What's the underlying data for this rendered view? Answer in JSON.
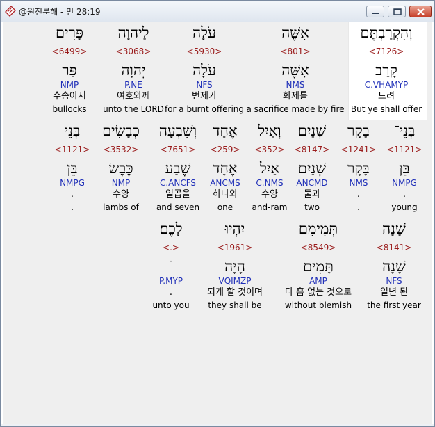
{
  "window": {
    "title": "@원전분해 - 민 28:19",
    "icon": "bible-app-icon",
    "controls": {
      "minimize": "minimize-icon",
      "maximize": "maximize-icon",
      "close": "close-icon"
    }
  },
  "colors": {
    "strongs": "#9a1b1b",
    "parsing": "#1f2fb8",
    "text": "#000000",
    "background": "#efefef"
  },
  "rows": [
    {
      "words": [
        {
          "heb": "וְהִקְרַבְתֶּם",
          "num": "<7126>",
          "root": "קָרַב",
          "parse": "C.VHAMYP",
          "kor": "드려",
          "eng": "But ye shall offer",
          "highlight": true
        },
        {
          "heb": "אִשֶּׁה",
          "num": "<801>",
          "root": "אִשֶּׁה",
          "parse": "NMS",
          "kor": "화제를",
          "eng": "a sacrifice made by fire"
        },
        {
          "heb": "עֹלָה",
          "num": "<5930>",
          "root": "עֹלָה",
          "parse": "NFS",
          "kor": "번제가",
          "eng": "for a burnt offering"
        },
        {
          "heb": "לַיהוָה",
          "num": "<3068>",
          "root": "יְהוָה",
          "parse": "P.NE",
          "kor": "여호와께",
          "eng": "unto the LORD"
        },
        {
          "heb": "פָּרִים",
          "num": "<6499>",
          "root": "פַּר",
          "parse": "NMP",
          "kor": "수송아지",
          "eng": "bullocks"
        }
      ]
    },
    {
      "words": [
        {
          "heb": "בְּנֵי־",
          "num": "<1121>",
          "root": "בֵּן",
          "parse": "NMPG",
          "kor": ".",
          "eng": "young"
        },
        {
          "heb": "בָקָר",
          "num": "<1241>",
          "root": "בָּקָר",
          "parse": "NMS",
          "kor": ".",
          "eng": "."
        },
        {
          "heb": "שְׁנַיִם",
          "num": "<8147>",
          "root": "שְׁנַיִם",
          "parse": "ANCMD",
          "kor": "둘과",
          "eng": "two"
        },
        {
          "heb": "וְאַיִל",
          "num": "<352>",
          "root": "אַיִל",
          "parse": "C.NMS",
          "kor": "수양",
          "eng": "and-ram"
        },
        {
          "heb": "אֶחָד",
          "num": "<259>",
          "root": "אֶחָד",
          "parse": "ANCMS",
          "kor": "하나와",
          "eng": "one"
        },
        {
          "heb": "וְשִׁבְעָה",
          "num": "<7651>",
          "root": "שֶׁבַע",
          "parse": "C.ANCFS",
          "kor": "일곱을",
          "eng": "and seven"
        },
        {
          "heb": "כְבָשִׂים",
          "num": "<3532>",
          "root": "כֶּבֶשׂ",
          "parse": "NMP",
          "kor": "수양",
          "eng": "lambs of"
        },
        {
          "heb": "בְּנֵי",
          "num": "<1121>",
          "root": "בֵּן",
          "parse": "NMPG",
          "kor": ".",
          "eng": "."
        }
      ]
    },
    {
      "words": [
        {
          "heb": "שָׁנָה",
          "num": "<8141>",
          "root": "שָׁנָה",
          "parse": "NFS",
          "kor": "일년 된",
          "eng": "the first year"
        },
        {
          "heb": "תְּמִימִם",
          "num": "<8549>",
          "root": "תָּמִים",
          "parse": "AMP",
          "kor": "다 흠 없는 것으로",
          "eng": "without blemish"
        },
        {
          "heb": "יִהְיוּ",
          "num": "<1961>",
          "root": "הָיָה",
          "parse": "VQIMZP",
          "kor": "되게 할 것이며",
          "eng": "they shall be"
        },
        {
          "heb": "לָכֶם׃",
          "num": "<.>",
          "root": "ׁ",
          "parse": "P.MYP",
          "kor": ".",
          "eng": "unto you"
        }
      ]
    }
  ]
}
